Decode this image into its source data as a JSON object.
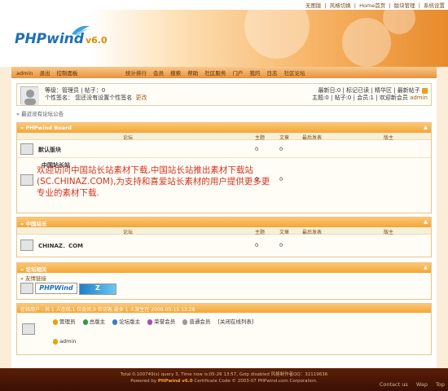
{
  "top_links": {
    "no_graphic": "无图版",
    "style_switch": "风格切换",
    "home": "Home首页",
    "forum_manage": "版块管理",
    "system_settings": "系统设置",
    "sep": "|"
  },
  "logo": {
    "brand": "PHPwind",
    "version": "v6.0"
  },
  "navbar": {
    "user": "admin",
    "logout": "退出",
    "control_panel": "控制面板",
    "items": [
      "统计排行",
      "会员",
      "搜索",
      "帮助",
      "社区服务",
      "门户",
      "我的",
      "日志",
      "社区论坛"
    ]
  },
  "userbox": {
    "level_line": "等级：管理员  |  帖子：0",
    "signature_line": "个性签名： 您还没有设置个性签名",
    "signature_edit": "更改",
    "today_posts": "最新日:0",
    "mark_read": "标记已读",
    "digest": "精华区",
    "new_posts": "最新帖子",
    "stats_line": "主题:0 | 帖子:0 | 会员:1 | 欢迎新会员",
    "new_member": "admin"
  },
  "notice": "最近没有论坛公告",
  "columns": {
    "forum": "论坛",
    "topics": "主题",
    "posts": "文章",
    "last_post": "最后发表",
    "moderator": "版主"
  },
  "sections": [
    {
      "title": "PHPwind Board",
      "forums": [
        {
          "name": "默认版块",
          "topics": "0",
          "posts": "0"
        },
        {
          "name": "中国站长站",
          "topics": "0",
          "posts": "0"
        }
      ]
    },
    {
      "title": "中国站长",
      "forums": [
        {
          "name": "CHINAZ．COM",
          "topics": "0",
          "posts": "0"
        }
      ]
    }
  ],
  "watermark_text": "欢迎访问中国站长站素材下载,中国站长站推出素材下载站(SC.CHINAZ.COM),为支持和喜爱站长素材的用户提供更多更专业的素材下载.",
  "links_section": {
    "title": "论坛相关",
    "subtitle": "友情链接",
    "banner1": "PHPWind",
    "banner2": "Z"
  },
  "online": {
    "summary": "在线用户 - 共 1 人在线,1 位会员,0 位访客,最多 1 人发生在 2009-05-15 13:28",
    "legend": [
      "管理员",
      "总版主",
      "论坛版主",
      "荣誉会员",
      "普通会员"
    ],
    "close_list": "[关闭在线列表]",
    "user": "admin"
  },
  "footer": {
    "line1": "Total 0.100749(s) query 3, Time now is:05-26 13:57, Gzip disabled 风格制作者QQ：32119636",
    "line2_prefix": "Powered by",
    "line2_brand": "PHPwind v6.0",
    "line2_suffix": "Certificate Code © 2003-07 PHPwind.com Corporation.",
    "links": [
      "Contact us",
      "Wap",
      "Top"
    ]
  },
  "colors": {
    "accent": "#f5a534",
    "footer_bg": "#3a1004",
    "watermark": "#d4341f"
  }
}
